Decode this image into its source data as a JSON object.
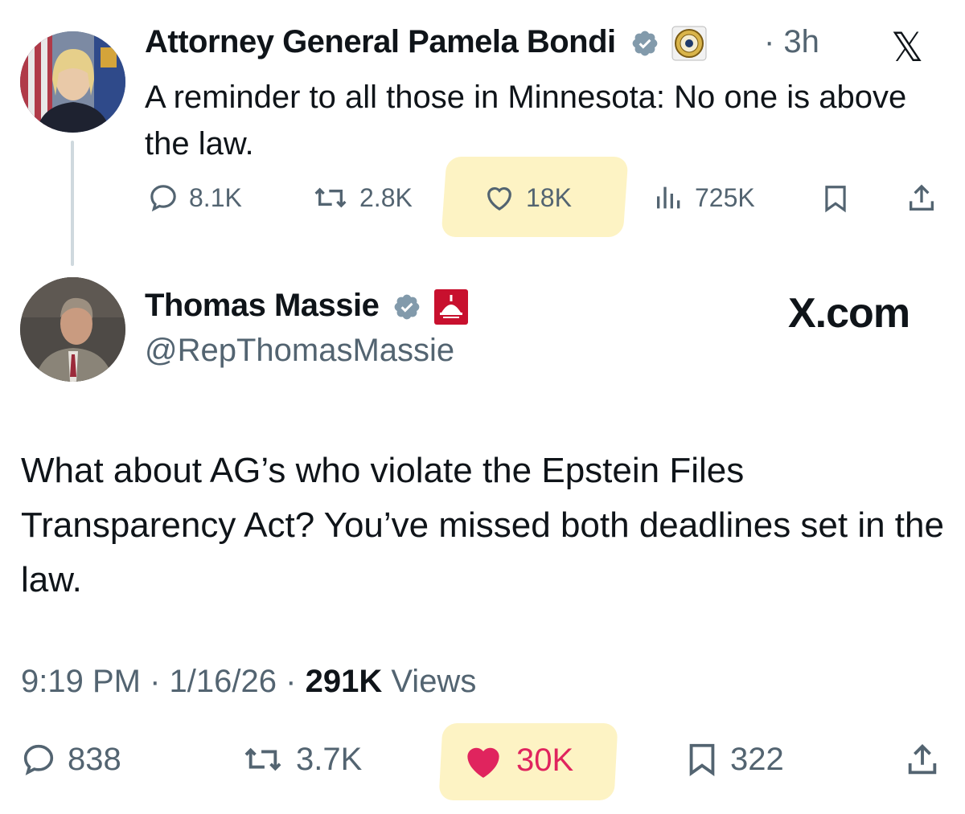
{
  "tweet1": {
    "author_name": "Attorney General Pamela Bondi",
    "time": "· 3h",
    "x_icon": "x-logo-icon",
    "text": "A reminder to all those in Minnesota:  No one is above the law.",
    "stats": {
      "replies": "8.1K",
      "reposts": "2.8K",
      "likes": "18K",
      "views": "725K"
    }
  },
  "tweet2": {
    "author_name": "Thomas Massie",
    "handle": "@RepThomasMassie",
    "site": "X.com",
    "text": "What about AG’s who violate the Epstein Files Transparency Act? You’ve missed both deadlines set in the law.",
    "meta": {
      "time": "9:19 PM",
      "date": "1/16/26",
      "views_count": "291K",
      "views_label": "Views",
      "sep": "·"
    },
    "stats": {
      "replies": "838",
      "reposts": "3.7K",
      "likes": "30K",
      "bookmarks": "322"
    }
  },
  "colors": {
    "verified": "#829aab",
    "highlight": "#fdf3c4",
    "like_red": "#e0245e",
    "muted": "#536471",
    "badge_red": "#c8102e"
  }
}
